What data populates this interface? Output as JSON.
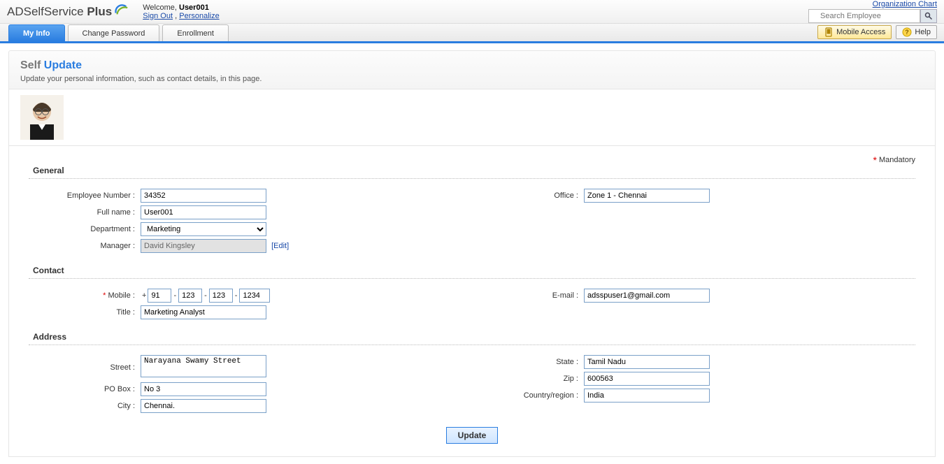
{
  "header": {
    "product_name_pre": "ADSelfService ",
    "product_name_bold": "Plus",
    "welcome_prefix": "Welcome, ",
    "user": "User001",
    "signout": "Sign Out",
    "personalize": "Personalize",
    "org_chart": "Organization Chart",
    "search_placeholder": "Search Employee"
  },
  "tabs": {
    "my_info": "My Info",
    "change_password": "Change Password",
    "enrollment": "Enrollment",
    "mobile_access": "Mobile Access",
    "help": "Help"
  },
  "page": {
    "title_self": "Self ",
    "title_update": "Update",
    "subtitle": "Update your personal information, such as contact details, in this page.",
    "mandatory_label": "Mandatory"
  },
  "sections": {
    "general": "General",
    "contact": "Contact",
    "address": "Address"
  },
  "labels": {
    "emp_no": "Employee Number :",
    "full_name": "Full name :",
    "department": "Department :",
    "manager": "Manager :",
    "edit": "[Edit]",
    "office": "Office :",
    "mobile": "Mobile :",
    "email": "E-mail :",
    "title": "Title :",
    "street": "Street :",
    "pobox": "PO Box :",
    "city": "City :",
    "state": "State :",
    "zip": "Zip :",
    "country": "Country/region :"
  },
  "values": {
    "emp_no": "34352",
    "full_name": "User001",
    "department": "Marketing",
    "manager": "David Kingsley",
    "office": "Zone 1 - Chennai",
    "mobile_cc": "91",
    "mobile_p1": "123",
    "mobile_p2": "123",
    "mobile_p3": "1234",
    "email": "adsspuser1@gmail.com",
    "title": "Marketing Analyst",
    "street": "Narayana Swamy Street",
    "pobox": "No 3",
    "city": "Chennai.",
    "state": "Tamil Nadu",
    "zip": "600563",
    "country": "India"
  },
  "buttons": {
    "update": "Update"
  }
}
